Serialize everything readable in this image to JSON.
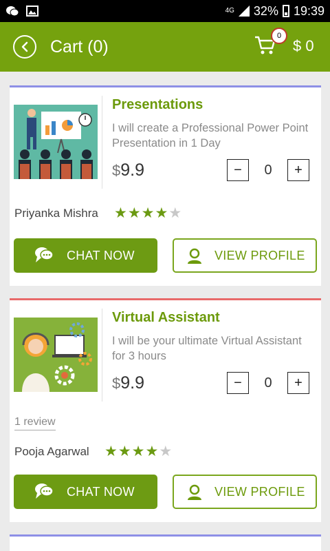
{
  "status_bar": {
    "network": "4G",
    "battery": "32%",
    "time": "19:39"
  },
  "header": {
    "title": "Cart (0)",
    "cart_badge": "0",
    "cart_total": "$ 0"
  },
  "cards": [
    {
      "title": "Presentations",
      "description": "I will create a Professional Power Point Presentation in 1 Day",
      "currency": "$",
      "price": "9.9",
      "quantity": "0",
      "seller": "Priyanka Mishra",
      "rating": 4,
      "rating_max": 5,
      "review_link": "",
      "chat_label": "CHAT NOW",
      "profile_label": "VIEW PROFILE"
    },
    {
      "title": "Virtual Assistant",
      "description": "I will be your ultimate Virtual Assistant for 3 hours",
      "currency": "$",
      "price": "9.9",
      "quantity": "0",
      "seller": "Pooja Agarwal",
      "rating": 4,
      "rating_max": 5,
      "review_link": "1 review",
      "chat_label": "CHAT NOW",
      "profile_label": "VIEW PROFILE"
    }
  ],
  "colors": {
    "accent": "#75a20e",
    "card_top_blue": "#8d8fe6",
    "card_top_red": "#e86a6a"
  },
  "icons": [
    "wechat-icon",
    "image-icon",
    "back-icon",
    "cart-icon",
    "chat-icon",
    "user-icon"
  ]
}
